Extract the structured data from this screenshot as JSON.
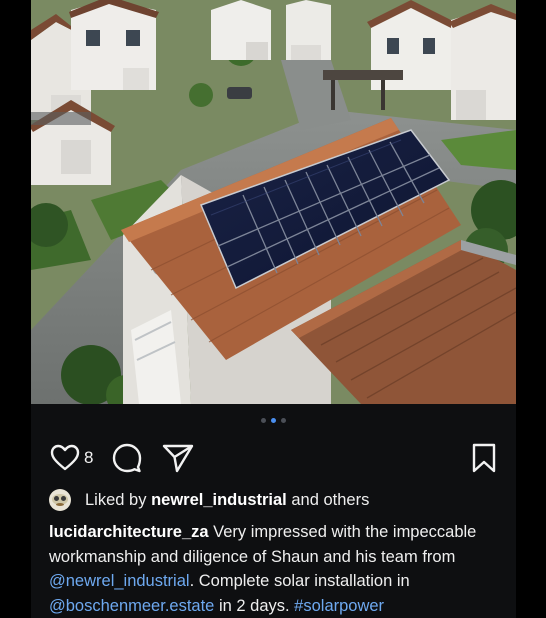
{
  "post": {
    "image_alt": "Aerial drone view of a house rooftop with installed solar panels in a residential estate",
    "carousel": {
      "count": 3,
      "active_index": 1
    },
    "actions": {
      "like_count": "8",
      "like_icon": "heart-outline-icon",
      "comment_icon": "comment-bubble-icon",
      "share_icon": "paper-plane-icon",
      "save_icon": "bookmark-icon"
    },
    "likes": {
      "prefix": "Liked by",
      "user": "newrel_industrial",
      "suffix": "and others"
    },
    "caption": {
      "username": "lucidarchitecture_za",
      "text_1": "Very impressed with the impeccable workmanship and diligence of Shaun and his team from",
      "mention_1": "@newrel_industrial",
      "text_2": ". Complete solar installation in",
      "mention_2": "@boschenmeer.estate",
      "text_3": "in 2 days.",
      "hashtag": "#solarpower"
    },
    "colors": {
      "background": "#0e0f11",
      "link": "#6ea9f0",
      "dot_active": "#4a8ff0",
      "dot_inactive": "#4b4f57"
    }
  }
}
